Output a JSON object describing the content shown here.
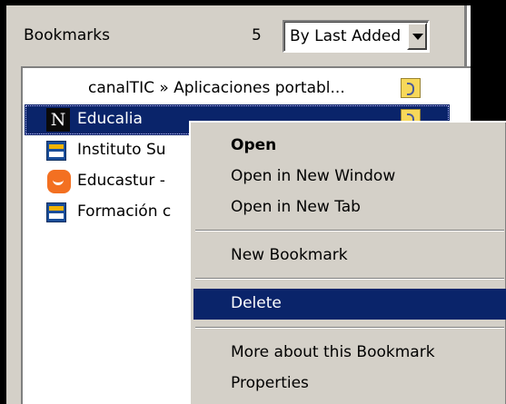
{
  "panel": {
    "title": "Bookmarks",
    "count": "5",
    "sort": {
      "selected": "By Last Added"
    }
  },
  "bookmarks": [
    {
      "label": "canalTIC » Aplicaciones portabl...",
      "icon": "none",
      "selected": false
    },
    {
      "label": "Educalia",
      "icon": "netscape-n-icon",
      "selected": true
    },
    {
      "label": "Instituto Su",
      "icon": "cnice-icon",
      "selected": false
    },
    {
      "label": "Educastur -",
      "icon": "educastur-icon",
      "selected": false
    },
    {
      "label": "Formación c",
      "icon": "cnice-icon",
      "selected": false
    }
  ],
  "context_menu": {
    "open": "Open",
    "open_new_window": "Open in New Window",
    "open_new_tab": "Open in New Tab",
    "new_bookmark": "New Bookmark",
    "delete": "Delete",
    "more_about": "More about this Bookmark",
    "properties": "Properties",
    "highlighted": "delete"
  },
  "colors": {
    "selection": "#0a246a",
    "panel_bg": "#d4d0c8"
  }
}
